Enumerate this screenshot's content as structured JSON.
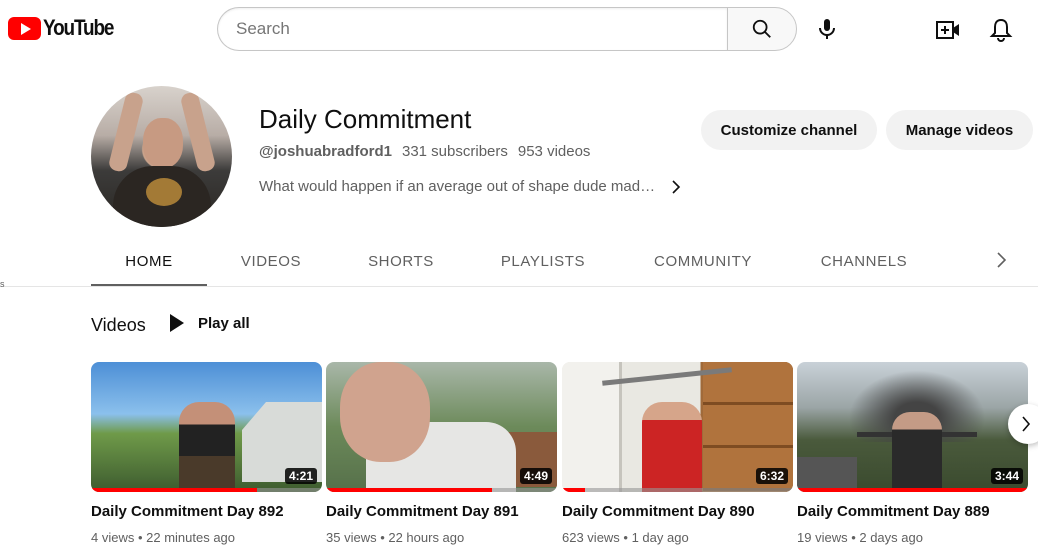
{
  "app": {
    "logo_text": "YouTube",
    "brand_color": "#ff0000"
  },
  "search": {
    "placeholder": "Search",
    "value": ""
  },
  "icons": {
    "search": "search-icon",
    "mic": "mic-icon",
    "create": "create-video-icon",
    "notifications": "bell-icon"
  },
  "channel": {
    "name": "Daily Commitment",
    "handle": "@joshuabradford1",
    "subscribers": "331 subscribers",
    "video_count": "953 videos",
    "description": "What would happen if an average out of shape dude mad…",
    "customize_label": "Customize channel",
    "manage_label": "Manage videos"
  },
  "tabs": [
    {
      "label": "HOME",
      "active": true
    },
    {
      "label": "VIDEOS",
      "active": false
    },
    {
      "label": "SHORTS",
      "active": false
    },
    {
      "label": "PLAYLISTS",
      "active": false
    },
    {
      "label": "COMMUNITY",
      "active": false
    },
    {
      "label": "CHANNELS",
      "active": false
    }
  ],
  "section": {
    "title": "Videos",
    "play_all": "Play all"
  },
  "videos": [
    {
      "title": "Daily Commitment Day 892",
      "duration": "4:21",
      "meta": "4 views • 22 minutes ago",
      "watched_fraction": 0.72
    },
    {
      "title": "Daily Commitment Day 891",
      "duration": "4:49",
      "meta": "35 views • 22 hours ago",
      "watched_fraction": 0.72
    },
    {
      "title": "Daily Commitment Day 890",
      "duration": "6:32",
      "meta": "623 views • 1 day ago",
      "watched_fraction": 0.1
    },
    {
      "title": "Daily Commitment Day 889",
      "duration": "3:44",
      "meta": "19 views • 2 days ago",
      "watched_fraction": 1.0
    }
  ]
}
